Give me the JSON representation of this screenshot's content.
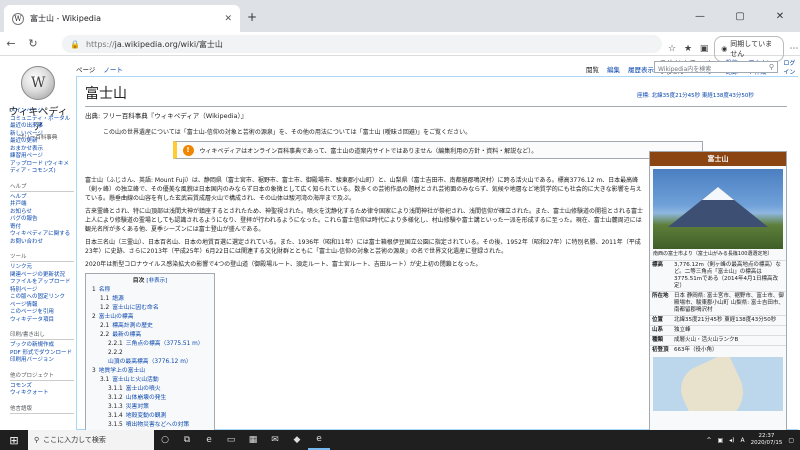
{
  "browser": {
    "tab_title": "富士山 - Wikipedia",
    "tab_favicon": "W",
    "new_tab": "+",
    "url_prefix": "https://",
    "url": "ja.wikipedia.org/wiki/富士山",
    "profile_label": "同期していません",
    "window_controls": [
      "—",
      "▢",
      "✕"
    ]
  },
  "wiki": {
    "logo_name": "ウィキペディア",
    "logo_tagline": "フリー百科事典",
    "top_links": [
      "ログインしていません",
      "トーク",
      "投稿記録",
      "アカウント作成",
      "ログイン"
    ],
    "left_tabs": [
      "ページ",
      "ノート"
    ],
    "right_tabs": [
      "閲覧",
      "編集",
      "履歴表示"
    ],
    "search_placeholder": "Wikipedia内を検索",
    "sidebar": [
      {
        "title": "",
        "links": [
          "メインページ",
          "コミュニティ・ポータル",
          "最近の出来事",
          "新しいページ",
          "最近の更新",
          "おまかせ表示",
          "練習用ページ",
          "アップロード (ウィキメディア・コモンズ)"
        ]
      },
      {
        "title": "ヘルプ",
        "links": [
          "ヘルプ",
          "井戸端",
          "お知らせ",
          "バグの報告",
          "寄付",
          "ウィキペディアに関するお問い合わせ"
        ]
      },
      {
        "title": "ツール",
        "links": [
          "リンク元",
          "関連ページの更新状況",
          "ファイルをアップロード",
          "特別ページ",
          "この版への固定リンク",
          "ページ情報",
          "このページを引用",
          "ウィキデータ項目"
        ]
      },
      {
        "title": "印刷/書き出し",
        "links": [
          "ブックの新規作成",
          "PDF 形式でダウンロード",
          "印刷用バージョン"
        ]
      },
      {
        "title": "他のプロジェクト",
        "links": [
          "コモンズ",
          "ウィキクォート"
        ]
      },
      {
        "title": "他言語版",
        "links": []
      }
    ],
    "article": {
      "title": "富士山",
      "from": "出典: フリー百科事典『ウィキペディア（Wikipedia）』",
      "coords": "座標: 北緯35度21分45秒 東経138度43分50秒",
      "hatnote": "この山の世界遺産については「富士山-信仰の対象と芸術の源泉」を、その他の用法については「富士山 (曖昧さ回避)」をご覧ください。",
      "notice": "ウィキペディアはオンライン百科事典であって、富士山の道案内サイトではありません（編集利用の方針・資料・解説など）。",
      "paragraphs": [
        "富士山（ふじさん、英語: Mount Fuji）は、静岡県（富士宮市、裾野市、富士市、御殿場市、駿東郡小山町）と、山梨県（富士吉田市、南都留郡鳴沢村）に跨る活火山である。標高3776.12 m、日本最高峰（剣ヶ峰）の独立峰で、その優美な風貌は日本国内のみならず日本の象徴として広く知られている。数多くの芸術作品の題材とされ芸術面のみならず、気候や地層など地質学的にも社会的に大きな影響を与えている。懸垂曲線の山容を有した玄武岩質成層火山で構成され、その山体は駿河湾の海岸まで及ぶ。",
        "古来霊峰とされ、特に山頂部は浅間大神が鎮座するとされたため、神聖視された。噴火を沈静化するため律令国家により浅間神社が祭祀され、浅間信仰が確立された。また、富士山修験道の開祖とされる富士上人により修験道の霊場としても認識されるようになり、登拝が行われるようになった。これら富士信仰は時代により多様化し、村山修験や富士講といった一派を形成するに至った。現在、富士山麓周辺には観光名所が多くある他、夏季シーズンには富士登山が盛んである。",
        "日本三名山（三霊山）、日本百名山、日本の地質百選に選定されている。また、1936年（昭和11年）には富士箱根伊豆国立公園に指定されている。その後、1952年（昭和27年）に特別名勝、2011年（平成23年）に史跡、さらに2013年（平成25年）6月22日には関連する文化財群とともに「富士山-信仰の対象と芸術の源泉」の名で世界文化遺産に登録された。",
        "2020年は新型コロナウイルス感染拡大の影響で4つの登山道（御殿場ルート、須走ルート、富士宮ルート、吉田ルート）が史上初の閉鎖となった。"
      ],
      "toc_title": "目次",
      "toc_toggle": "[非表示]",
      "toc": [
        {
          "n": "1",
          "t": "名称",
          "lvl": 1
        },
        {
          "n": "1.1",
          "t": "語源",
          "lvl": 2
        },
        {
          "n": "1.2",
          "t": "富士山に因む命名",
          "lvl": 2
        },
        {
          "n": "2",
          "t": "富士山の標高",
          "lvl": 1
        },
        {
          "n": "2.1",
          "t": "標高計測の歴史",
          "lvl": 2
        },
        {
          "n": "2.2",
          "t": "最新の標高",
          "lvl": 2
        },
        {
          "n": "2.2.1",
          "t": "三角点の標高（3775.51 m）",
          "lvl": 3
        },
        {
          "n": "2.2.2",
          "t": "山頂の最高標高（3776.12 m）",
          "lvl": 3
        },
        {
          "n": "3",
          "t": "地質学上の富士山",
          "lvl": 1
        },
        {
          "n": "3.1",
          "t": "富士山と火山活動",
          "lvl": 2
        },
        {
          "n": "3.1.1",
          "t": "富士山の噴火",
          "lvl": 3
        },
        {
          "n": "3.1.2",
          "t": "山体崩壊の発生",
          "lvl": 3
        },
        {
          "n": "3.1.3",
          "t": "災害対策",
          "lvl": 3
        },
        {
          "n": "3.1.4",
          "t": "地殻変動の観測",
          "lvl": 3
        },
        {
          "n": "3.1.5",
          "t": "噴出物災害などへの対策",
          "lvl": 3
        },
        {
          "n": "3.2",
          "t": "富士山と気象",
          "lvl": 2
        },
        {
          "n": "3.2.1",
          "t": "気候",
          "lvl": 3
        },
        {
          "n": "3.2.2",
          "t": "富士山での気象観測",
          "lvl": 3
        }
      ]
    },
    "infobox": {
      "title": "富士山",
      "caption": "南西の富士市より（富士山がみる長篠100選選定地）",
      "rows": [
        {
          "k": "標高",
          "v": "3,776.12m（剣ヶ峰の最高地点の標高）など。二等三角点「富士山」の標高は3775.51mである（2014年4月1日標高改定）"
        },
        {
          "k": "所在地",
          "v": "日本 静岡県: 富士宮市、裾野市、富士市、御殿場市、駿東郡小山町 山梨県: 富士吉田市、南都留郡鳴沢村"
        },
        {
          "k": "位置",
          "v": "北緯35度21分45秒 東経138度43分50秒"
        },
        {
          "k": "山系",
          "v": "独立峰"
        },
        {
          "k": "種類",
          "v": "成層火山・活火山ランクB"
        },
        {
          "k": "初登頂",
          "v": "663年（役小角）"
        }
      ]
    }
  },
  "taskbar": {
    "search_placeholder": "ここに入力して検索",
    "time": "22:37",
    "date": "2020/07/15"
  }
}
